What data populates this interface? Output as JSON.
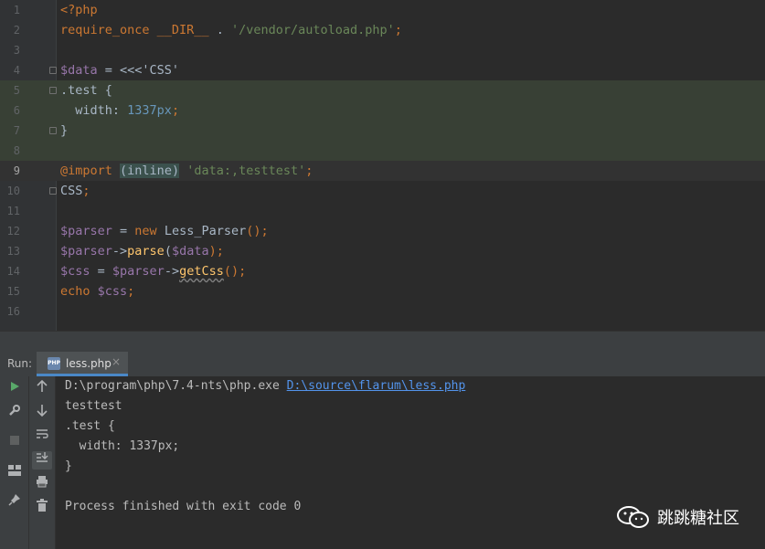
{
  "editor": {
    "lines": [
      {
        "n": "1",
        "tokens": [
          {
            "t": "<?php",
            "c": "kw"
          }
        ]
      },
      {
        "n": "2",
        "tokens": [
          {
            "t": "require_once ",
            "c": "kw"
          },
          {
            "t": "__DIR__",
            "c": "kw"
          },
          {
            "t": " . ",
            "c": ""
          },
          {
            "t": "'/vendor/autoload.php'",
            "c": "str"
          },
          {
            "t": ";",
            "c": "kw"
          }
        ]
      },
      {
        "n": "3",
        "tokens": []
      },
      {
        "n": "4",
        "tokens": [
          {
            "t": "$data",
            "c": "var"
          },
          {
            "t": " = ",
            "c": ""
          },
          {
            "t": "<<<'CSS'",
            "c": ""
          }
        ]
      },
      {
        "n": "5",
        "tokens": [
          {
            "t": ".test {",
            "c": ""
          }
        ]
      },
      {
        "n": "6",
        "tokens": [
          {
            "t": "  width: ",
            "c": ""
          },
          {
            "t": "1337px",
            "c": "num"
          },
          {
            "t": ";",
            "c": "kw"
          }
        ]
      },
      {
        "n": "7",
        "tokens": [
          {
            "t": "}",
            "c": ""
          }
        ]
      },
      {
        "n": "8",
        "tokens": []
      },
      {
        "n": "9",
        "tokens": [
          {
            "t": "@import",
            "c": "kw"
          },
          {
            "t": " ",
            "c": ""
          },
          {
            "t": "(inline)",
            "c": "bracket"
          },
          {
            "t": " ",
            "c": ""
          },
          {
            "t": "'data:,testtest'",
            "c": "str"
          },
          {
            "t": ";",
            "c": "kw"
          }
        ]
      },
      {
        "n": "10",
        "tokens": [
          {
            "t": "CSS",
            "c": ""
          },
          {
            "t": ";",
            "c": "kw"
          }
        ]
      },
      {
        "n": "11",
        "tokens": []
      },
      {
        "n": "12",
        "tokens": [
          {
            "t": "$parser",
            "c": "var"
          },
          {
            "t": " = ",
            "c": ""
          },
          {
            "t": "new ",
            "c": "kw"
          },
          {
            "t": "Less_Parser",
            "c": ""
          },
          {
            "t": "();",
            "c": "kw"
          }
        ]
      },
      {
        "n": "13",
        "tokens": [
          {
            "t": "$parser",
            "c": "var"
          },
          {
            "t": "->",
            "c": ""
          },
          {
            "t": "parse",
            "c": "fn"
          },
          {
            "t": "(",
            "c": ""
          },
          {
            "t": "$data",
            "c": "var"
          },
          {
            "t": ");",
            "c": "kw"
          }
        ]
      },
      {
        "n": "14",
        "tokens": [
          {
            "t": "$css",
            "c": "var"
          },
          {
            "t": " = ",
            "c": ""
          },
          {
            "t": "$parser",
            "c": "var"
          },
          {
            "t": "->",
            "c": ""
          },
          {
            "t": "getCss",
            "c": "fn wavy"
          },
          {
            "t": "();",
            "c": "kw"
          }
        ]
      },
      {
        "n": "15",
        "tokens": [
          {
            "t": "echo ",
            "c": "kw"
          },
          {
            "t": "$css",
            "c": "var"
          },
          {
            "t": ";",
            "c": "kw"
          }
        ]
      },
      {
        "n": "16",
        "tokens": []
      }
    ]
  },
  "run_panel": {
    "label": "Run:",
    "tab_label": "less.php",
    "tab_icon_text": "PHP",
    "tab_close": "×",
    "console": {
      "command_prefix": "D:\\program\\php\\7.4-nts\\php.exe ",
      "command_link": "D:\\source\\flarum\\less.php",
      "output": [
        "testtest",
        ".test {",
        "  width: 1337px;",
        "}",
        "",
        "Process finished with exit code 0"
      ]
    }
  },
  "watermark": {
    "text": "跳跳糖社区"
  },
  "colors": {
    "keyword": "#cc7832",
    "variable": "#9876aa",
    "string": "#6a8759",
    "number": "#6897bb",
    "function": "#ffc66d",
    "link": "#5394ec",
    "injected_bg": "#384035"
  }
}
